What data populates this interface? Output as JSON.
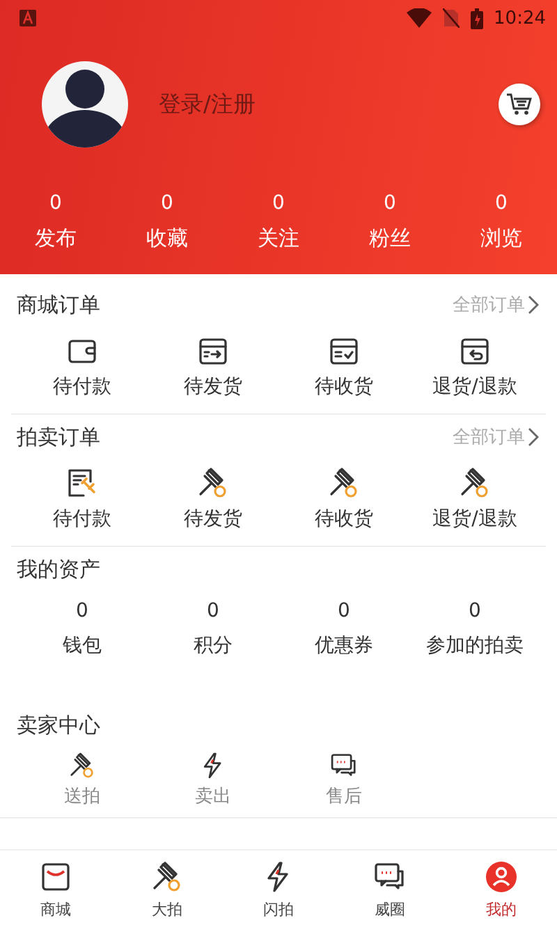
{
  "status_bar": {
    "time": "10:24"
  },
  "profile": {
    "login_label": "登录/注册"
  },
  "stats": [
    {
      "value": "0",
      "label": "发布"
    },
    {
      "value": "0",
      "label": "收藏"
    },
    {
      "value": "0",
      "label": "关注"
    },
    {
      "value": "0",
      "label": "粉丝"
    },
    {
      "value": "0",
      "label": "浏览"
    }
  ],
  "mall_orders": {
    "title": "商城订单",
    "link": "全部订单",
    "items": [
      {
        "kind": "wallet",
        "label": "待付款"
      },
      {
        "kind": "ship",
        "label": "待发货"
      },
      {
        "kind": "receive",
        "label": "待收货"
      },
      {
        "kind": "return",
        "label": "退货/退款"
      }
    ]
  },
  "auction_orders": {
    "title": "拍卖订单",
    "link": "全部订单",
    "items": [
      {
        "kind": "document",
        "label": "待付款"
      },
      {
        "kind": "gavel",
        "label": "待发货"
      },
      {
        "kind": "gavel",
        "label": "待收货"
      },
      {
        "kind": "gavel",
        "label": "退货/退款"
      }
    ]
  },
  "assets": {
    "title": "我的资产",
    "items": [
      {
        "value": "0",
        "label": "钱包"
      },
      {
        "value": "0",
        "label": "积分"
      },
      {
        "value": "0",
        "label": "优惠券"
      },
      {
        "value": "0",
        "label": "参加的拍卖"
      }
    ]
  },
  "seller_center": {
    "title": "卖家中心",
    "items": [
      {
        "kind": "gavel",
        "label": "送拍"
      },
      {
        "kind": "flash",
        "label": "卖出"
      },
      {
        "kind": "chat",
        "label": "售后"
      }
    ]
  },
  "bottom_nav": [
    {
      "kind": "bag",
      "label": "商城",
      "selected": false
    },
    {
      "kind": "gavel",
      "label": "大拍",
      "selected": false
    },
    {
      "kind": "flash",
      "label": "闪拍",
      "selected": false
    },
    {
      "kind": "chat",
      "label": "威圈",
      "selected": false
    },
    {
      "kind": "user",
      "label": "我的",
      "selected": true
    }
  ]
}
